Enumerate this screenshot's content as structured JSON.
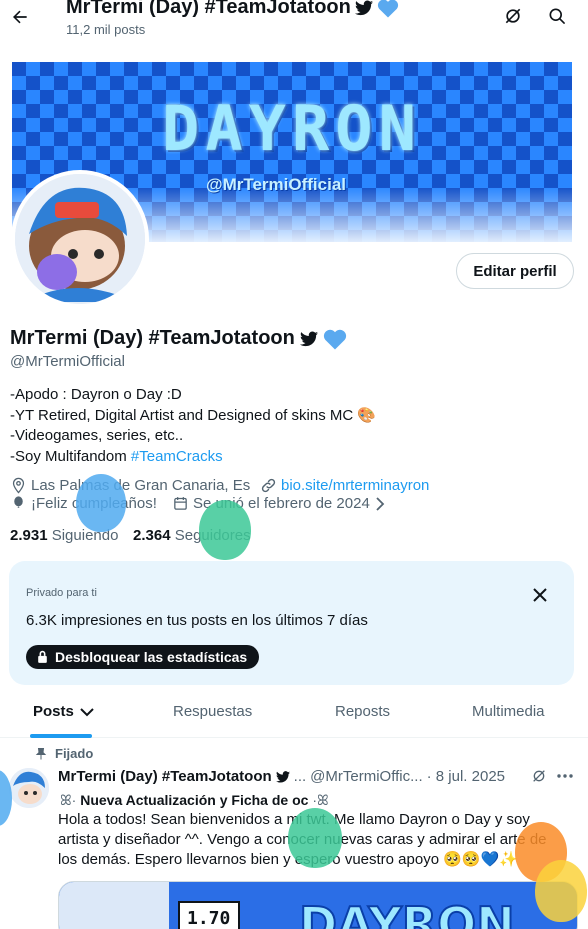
{
  "header": {
    "back_label": "←",
    "name": "MrTermi (Day) #TeamJotatoon",
    "posts_count": "11,2 mil posts"
  },
  "banner": {
    "title": "DAYRON",
    "handle": "@MrTermiOfficial"
  },
  "profile": {
    "edit_label": "Editar perfil",
    "name": "MrTermi (Day) #TeamJotatoon",
    "handle": "@MrTermiOfficial",
    "bio": [
      "-Apodo : Dayron o Day :D",
      "-YT Retired, Digital Artist and Designed of skins MC",
      "-Videogames, series, etc..",
      "-Soy Multifandom "
    ],
    "bio_hashtag": "#TeamCracks",
    "location": "Las Palmas de Gran Canaria, Es",
    "website": "bio.site/mrterminayron",
    "birthday": "¡Feliz cumpleaños!",
    "joined": "Se unió el febrero de 2024",
    "following_count": "2.931",
    "following_label": "Siguiendo",
    "followers_count": "2.364",
    "followers_label": "Seguidores"
  },
  "stats_card": {
    "label": "Privado para ti",
    "text": "6.3K impresiones en tus posts en los últimos 7 días",
    "button": "Desbloquear las estadísticas"
  },
  "tabs": [
    {
      "label": "Posts"
    },
    {
      "label": "Respuestas"
    },
    {
      "label": "Reposts"
    },
    {
      "label": "Multimedia"
    }
  ],
  "post": {
    "pinned_label": "Fijado",
    "name": "MrTermi (Day) #TeamJotatoon",
    "handle": "@MrTermiOffic...",
    "date": "· 8 jul. 2025",
    "title": "Nueva Actualización y Ficha de oc",
    "body": "Hola a todos! Sean bienvenidos a mi twt. Me llamo Dayron o Day y soy artista y diseñador ^^. Vengo a conocer nuevas caras y admirar el arte de los demás. Espero llevarnos bien y espero vuestro apoyo"
  },
  "colors": {
    "accent": "#1d9bf0",
    "text": "#0f1419",
    "muted": "#536471",
    "card": "#e8f5fd",
    "heart": "#5aa9ef"
  }
}
